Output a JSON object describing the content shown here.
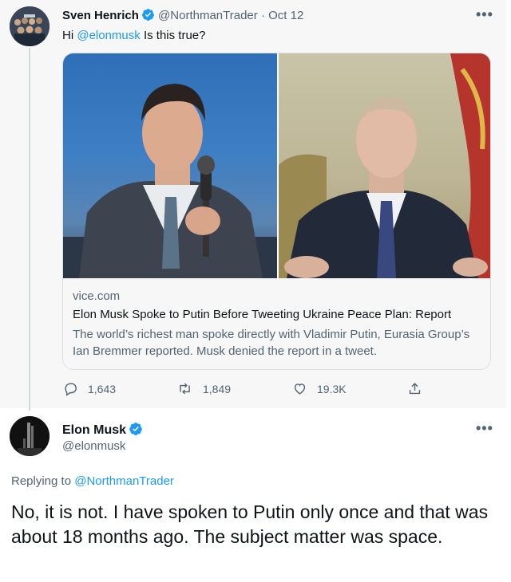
{
  "tweet": {
    "author_name": "Sven Henrich",
    "author_handle": "@NorthmanTrader",
    "date": "· Oct 12",
    "text_prefix": "Hi ",
    "mention": "@elonmusk",
    "text_suffix": " Is this true?",
    "card": {
      "domain": "vice.com",
      "title": "Elon Musk Spoke to Putin Before Tweeting Ukraine Peace Plan: Report",
      "description": "The world’s richest man spoke directly with Vladimir Putin, Eurasia Group’s Ian Bremmer reported. Musk denied the report in a tweet."
    },
    "actions": {
      "replies": "1,643",
      "retweets": "1,849",
      "likes": "19.3K"
    },
    "more_label": "•••"
  },
  "reply": {
    "author_name": "Elon Musk",
    "author_handle": "@elonmusk",
    "replying_prefix": "Replying to ",
    "replying_to": "@NorthmanTrader",
    "text": "No, it is not. I have spoken to Putin only once and that was about 18 months ago. The subject matter was space.",
    "more_label": "•••"
  },
  "colors": {
    "link": "#1d9bf0",
    "verified": "#1d9bf0",
    "muted": "#536471"
  },
  "icons": [
    "reply-icon",
    "retweet-icon",
    "like-icon",
    "share-icon",
    "verified-badge-icon",
    "more-icon"
  ]
}
